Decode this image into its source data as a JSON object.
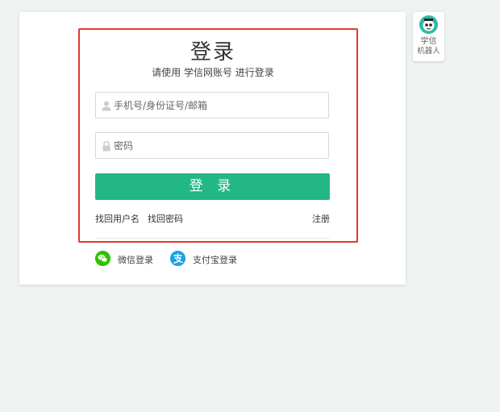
{
  "login": {
    "title": "登录",
    "subtitle": "请使用 学信网账号 进行登录",
    "username_placeholder": "手机号/身份证号/邮箱",
    "password_placeholder": "密码",
    "login_button": "登 录",
    "find_username": "找回用户名",
    "find_password": "找回密码",
    "register": "注册"
  },
  "social": {
    "wechat": "微信登录",
    "alipay": "支付宝登录"
  },
  "robot": {
    "line1": "学信",
    "line2": "机器人"
  },
  "colors": {
    "accent": "#22b785",
    "highlight_border": "#e2382e",
    "wechat": "#2ec100",
    "alipay": "#1ba2e1"
  }
}
